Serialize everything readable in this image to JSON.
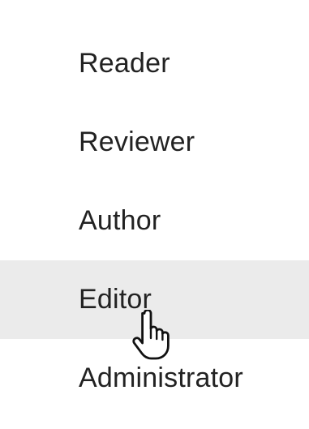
{
  "menu": {
    "items": [
      {
        "label": "Reader",
        "hovered": false
      },
      {
        "label": "Reviewer",
        "hovered": false
      },
      {
        "label": "Author",
        "hovered": false
      },
      {
        "label": "Editor",
        "hovered": true
      },
      {
        "label": "Administrator",
        "hovered": false
      }
    ]
  },
  "colors": {
    "text": "#222222",
    "hover_background": "#ebebeb",
    "background": "#ffffff"
  },
  "cursor": {
    "icon": "hand-pointer-icon"
  }
}
